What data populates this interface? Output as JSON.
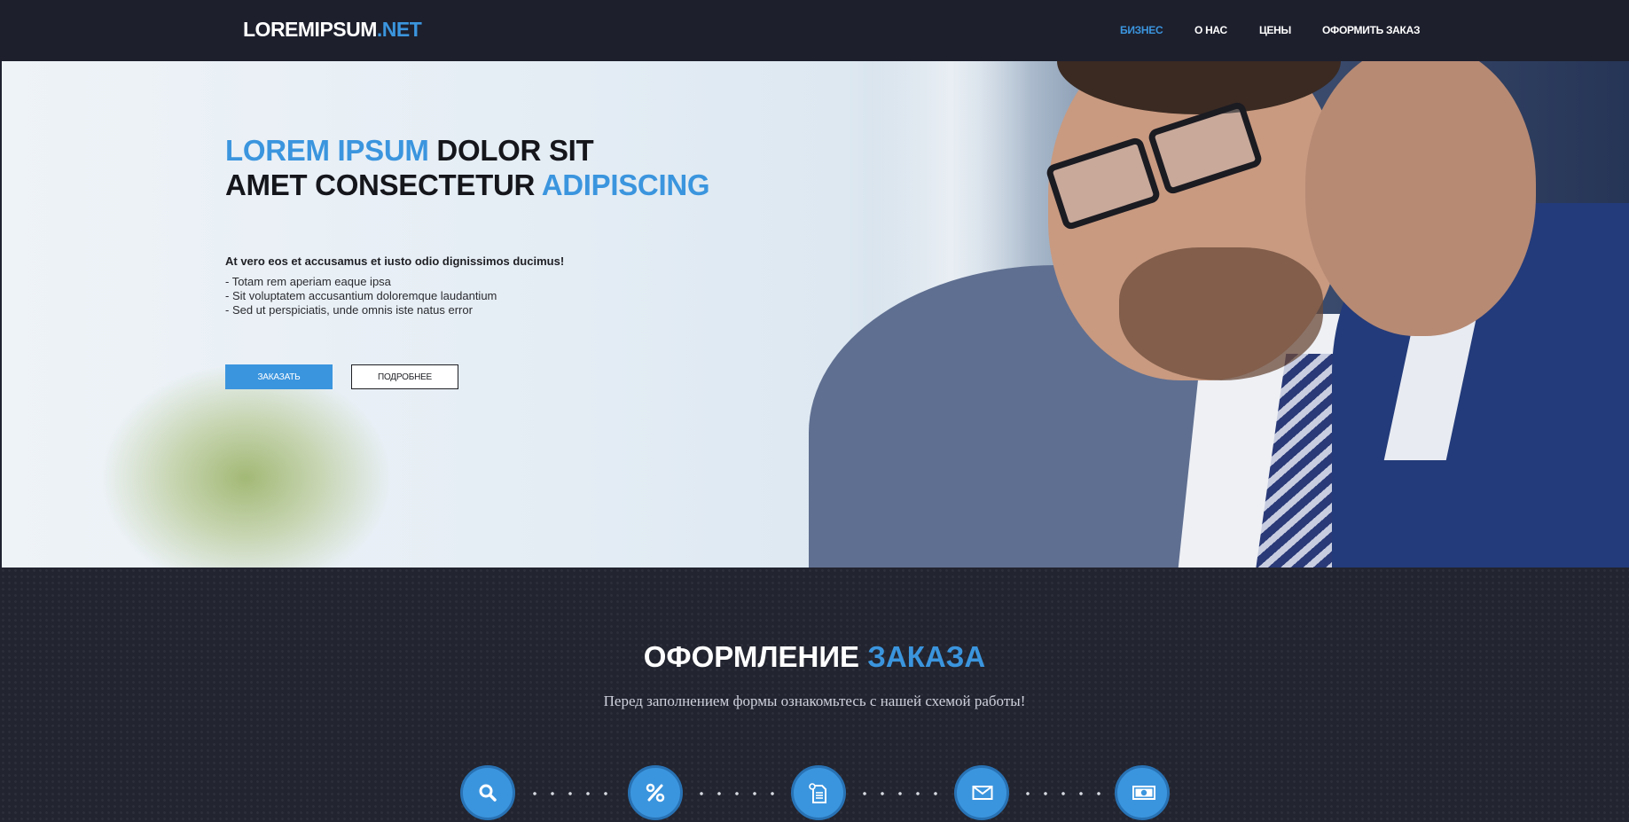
{
  "header": {
    "logo_main": "LOREMIPSUM",
    "logo_accent": ".NET",
    "nav": [
      {
        "label": "БИЗНЕС",
        "active": true
      },
      {
        "label": "О НАС",
        "active": false
      },
      {
        "label": "ЦЕНЫ",
        "active": false
      },
      {
        "label": "ОФОРМИТЬ ЗАКАЗ",
        "active": false
      }
    ]
  },
  "hero": {
    "title_line1_accent": "LOREM IPSUM",
    "title_line1_rest": "DOLOR SIT",
    "title_line2_rest": "AMET CONSECTETUR",
    "title_line2_accent": "ADIPISCING",
    "lead": "At vero eos et accusamus et iusto odio dignissimos ducimus!",
    "list": [
      "- Totam rem aperiam eaque ipsa",
      "- Sit voluptatem accusantium doloremque laudantium",
      "- Sed ut perspiciatis, unde omnis iste natus error"
    ],
    "primary_button": "ЗАКАЗАТЬ",
    "secondary_button": "ПОДРОБНЕЕ"
  },
  "order": {
    "title_main": "ОФОРМЛЕНИЕ",
    "title_accent": "ЗАКАЗА",
    "subtitle": "Перед заполнением формы ознакомьтесь с нашей схемой работы!",
    "steps": [
      {
        "icon": "search-icon"
      },
      {
        "icon": "percent-icon"
      },
      {
        "icon": "document-icon"
      },
      {
        "icon": "envelope-icon"
      },
      {
        "icon": "money-icon"
      }
    ]
  },
  "colors": {
    "accent": "#3b95de",
    "background_dark": "#1f2130",
    "header_bg": "#1d1f2d"
  }
}
